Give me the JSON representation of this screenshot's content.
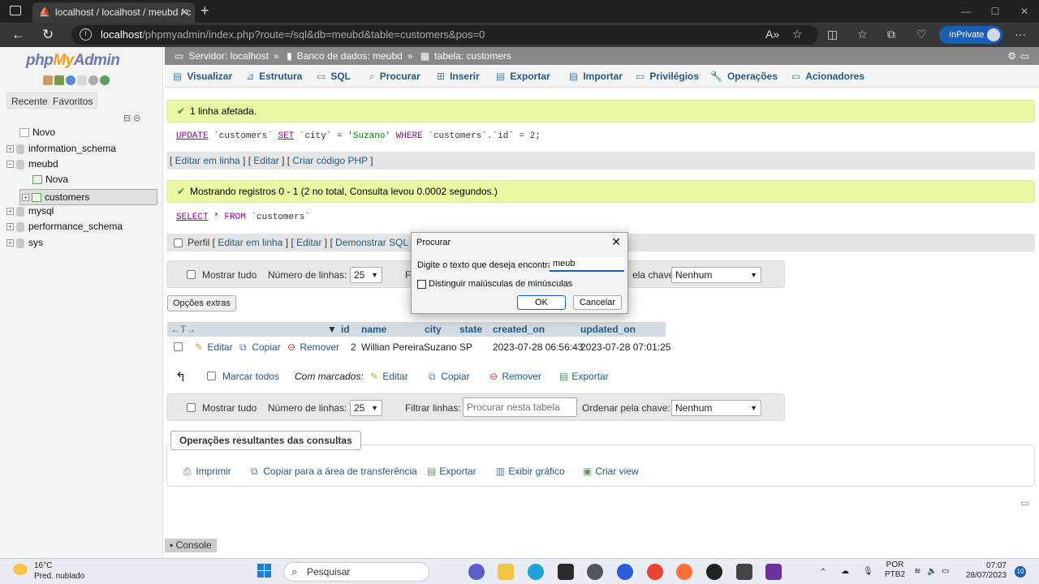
{
  "browser": {
    "tab_title": "localhost / localhost / meubd / c",
    "url_host": "localhost",
    "url_path": "/phpmyadmin/index.php?route=/sql&db=meubd&table=customers&pos=0",
    "inprivate_label": "InPrivate"
  },
  "sidebar": {
    "logo_php": "php",
    "logo_my": "My",
    "logo_admin": "Admin",
    "tab_recent": "Recente",
    "tab_favorites": "Favoritos",
    "tree": [
      {
        "label": "Novo"
      },
      {
        "label": "information_schema"
      },
      {
        "label": "meubd"
      },
      {
        "label": "Nova"
      },
      {
        "label": "customers"
      },
      {
        "label": "mysql"
      },
      {
        "label": "performance_schema"
      },
      {
        "label": "sys"
      }
    ]
  },
  "breadcrumb": {
    "server": "Servidor: localhost",
    "database": "Banco de dados: meubd",
    "table": "tabela: customers"
  },
  "tabs": [
    "Visualizar",
    "Estrutura",
    "SQL",
    "Procurar",
    "Inserir",
    "Exportar",
    "Importar",
    "Privilégios",
    "Operações",
    "Acionadores"
  ],
  "msg1": "1 linha afetada.",
  "sql1": {
    "kw_update": "UPDATE",
    "table": " `customers` ",
    "kw_set": "SET",
    "mid": " `city` = ",
    "value": "'Suzano'",
    "kw_where": " WHERE ",
    "rest": "`customers`.`id` = 2;"
  },
  "actions1": {
    "edit_inline": "Editar em linha",
    "edit": "Editar",
    "create_php": "Criar código PHP"
  },
  "msg2": "Mostrando registros 0 - 1 (2 no total, Consulta levou 0.0002 segundos.)",
  "sql2": {
    "kw_select": "SELECT",
    "star": " * ",
    "kw_from": "FROM",
    "table": " `customers`"
  },
  "actions2": {
    "profile": "Perfil",
    "edit_inline": "Editar em linha",
    "edit": "Editar",
    "explain": "Demonstrar SQL",
    "create_php_trunc": "Cr"
  },
  "nav": {
    "show_all": "Mostrar tudo",
    "rows_label": "Número de linhas:",
    "rows_value": "25",
    "filter_label": "Filtrar linhas:",
    "filter_placeholder": "Procurar nesta tabela",
    "order_label": "Ordenar pela chave:",
    "order_label_trunc": "ela chave:",
    "filter_trunc": "F",
    "order_value": "Nenhum"
  },
  "extras_label": "Opções extras",
  "table": {
    "columns": [
      "id",
      "name",
      "city",
      "state",
      "created_on",
      "updated_on"
    ],
    "rows": [
      {
        "edit": "Editar",
        "copy": "Copiar",
        "remove": "Remover",
        "id": "2",
        "name": "Willian Pereira",
        "city": "Suzano",
        "state": "SP",
        "created_on": "2023-07-28 06:56:43",
        "updated_on": "2023-07-28 07:01:25"
      }
    ]
  },
  "bulk": {
    "mark_all": "Marcar todos",
    "with_marked": "Com marcados:",
    "edit": "Editar",
    "copy": "Copiar",
    "remove": "Remover",
    "export": "Exportar"
  },
  "query_ops": {
    "legend": "Operações resultantes das consultas",
    "print": "Imprimir",
    "copy_clipboard": "Copiar para a área de transferência",
    "export": "Exportar",
    "chart": "Exibir gráfico",
    "create_view": "Criar view"
  },
  "console_label": "Console",
  "dialog": {
    "title": "Procurar",
    "prompt": "Digite o texto que deseja encontrar",
    "input_value": "meub",
    "case_label": "Distinguir maiúsculas de minúsculas",
    "ok": "OK",
    "cancel": "Cancelar"
  },
  "taskbar": {
    "temp": "16°C",
    "weather": "Pred. nublado",
    "search": "Pesquisar",
    "lang1": "POR",
    "lang2": "PTB2",
    "time": "07:07",
    "date": "28/07/2023",
    "notif": "10"
  }
}
